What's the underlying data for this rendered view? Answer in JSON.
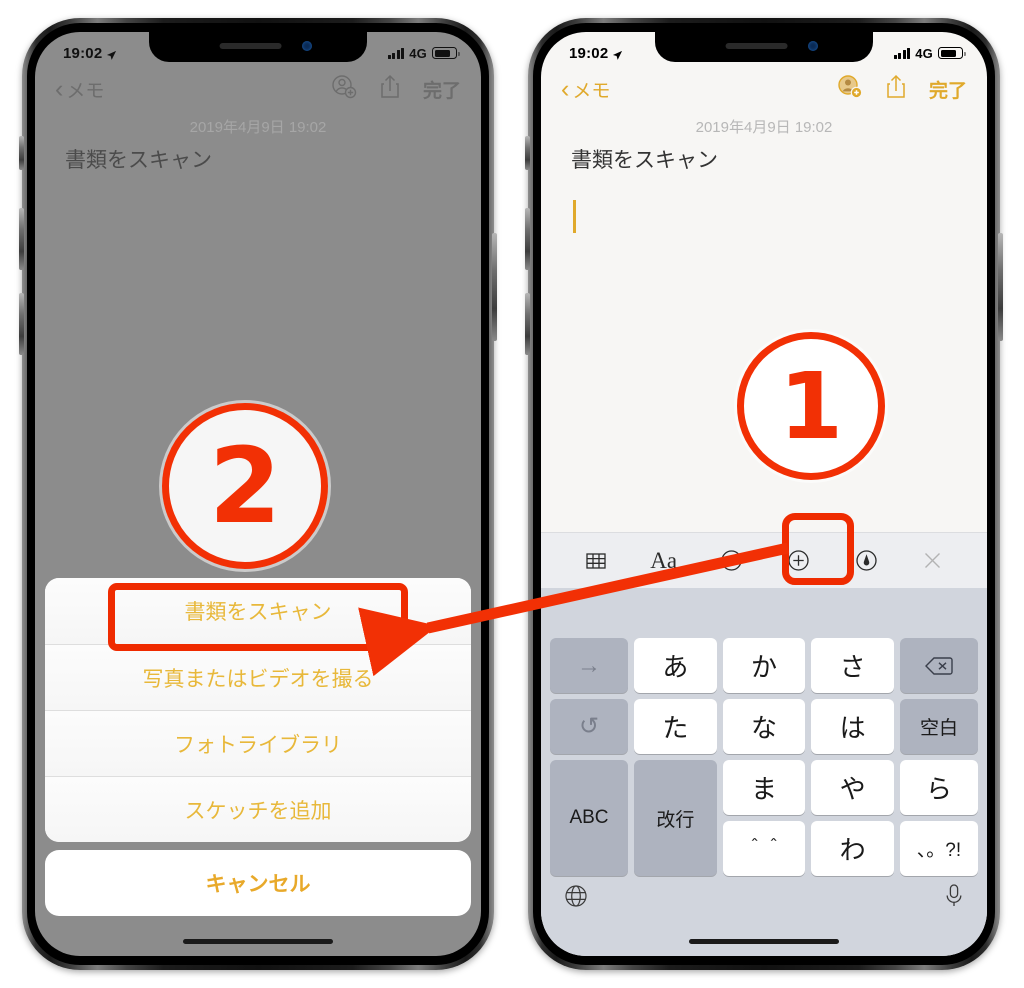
{
  "left_phone": {
    "status_bar": {
      "time": "19:02",
      "network": "4G",
      "location_icon": "location-arrow-icon",
      "signal_icon": "signal-bars-icon",
      "battery_icon": "battery-icon"
    },
    "nav": {
      "back_label": "メモ",
      "back_icon": "chevron-left-icon",
      "collaborate_icon": "add-person-icon",
      "share_icon": "share-icon",
      "done_label": "完了"
    },
    "note": {
      "date": "2019年4月9日 19:02",
      "title": "書類をスキャン"
    },
    "action_sheet": {
      "items": [
        {
          "label": "書類をスキャン",
          "highlighted": true
        },
        {
          "label": "写真またはビデオを撮る",
          "highlighted": false
        },
        {
          "label": "フォトライブラリ",
          "highlighted": false
        },
        {
          "label": "スケッチを追加",
          "highlighted": false
        }
      ],
      "cancel_label": "キャンセル"
    },
    "step_badge": "②"
  },
  "right_phone": {
    "status_bar": {
      "time": "19:02",
      "network": "4G",
      "location_icon": "location-arrow-icon",
      "signal_icon": "signal-bars-icon",
      "battery_icon": "battery-icon"
    },
    "nav": {
      "back_label": "メモ",
      "back_icon": "chevron-left-icon",
      "collaborate_icon": "add-person-icon",
      "share_icon": "share-icon",
      "done_label": "完了"
    },
    "note": {
      "date": "2019年4月9日 19:02",
      "title": "書類をスキャン"
    },
    "format_bar": {
      "icons": [
        {
          "name": "table-icon",
          "label": ""
        },
        {
          "name": "text-format-icon",
          "label": "Aa"
        },
        {
          "name": "checklist-icon",
          "label": ""
        },
        {
          "name": "add-attachment-icon",
          "label": "",
          "highlighted": true
        },
        {
          "name": "markup-pen-icon",
          "label": ""
        },
        {
          "name": "close-keyboard-icon",
          "label": ""
        }
      ]
    },
    "keyboard": {
      "rows": [
        [
          {
            "label": "→",
            "type": "dark"
          },
          {
            "label": "あ",
            "type": "light"
          },
          {
            "label": "か",
            "type": "light"
          },
          {
            "label": "さ",
            "type": "light"
          },
          {
            "label": "⌫",
            "type": "dark"
          }
        ],
        [
          {
            "label": "↺",
            "type": "dark"
          },
          {
            "label": "た",
            "type": "light"
          },
          {
            "label": "な",
            "type": "light"
          },
          {
            "label": "は",
            "type": "light"
          },
          {
            "label": "空白",
            "type": "dark"
          }
        ],
        [
          {
            "label": "ABC",
            "type": "dark"
          },
          {
            "label": "ま",
            "type": "light"
          },
          {
            "label": "や",
            "type": "light"
          },
          {
            "label": "ら",
            "type": "light"
          },
          {
            "label": "改行",
            "type": "dark"
          }
        ],
        [
          {
            "label": "",
            "type": "dark"
          },
          {
            "label": "＾＾",
            "type": "light"
          },
          {
            "label": "わ",
            "type": "light"
          },
          {
            "label": "、。?!",
            "type": "light"
          },
          {
            "label": "",
            "type": "dark"
          }
        ]
      ],
      "globe_icon": "globe-icon",
      "mic_icon": "microphone-icon"
    },
    "step_badge": "①"
  },
  "annotations": {
    "arrow": {
      "name": "red-arrow",
      "color": "#f23005",
      "from": "add-attachment-icon",
      "to": "scan-document-menu-item"
    },
    "highlight_color": "#ef2b00"
  }
}
